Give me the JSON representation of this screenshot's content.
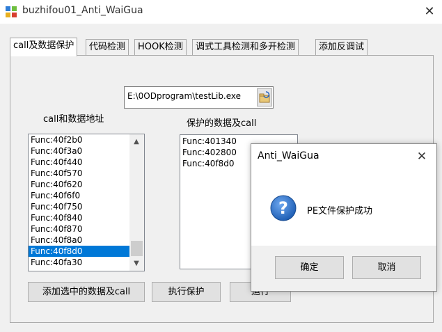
{
  "window": {
    "title": "buzhifou01_Anti_WaiGua",
    "close_glyph": "✕"
  },
  "tabs": [
    {
      "label": "call及数据保护"
    },
    {
      "label": "代码检测"
    },
    {
      "label": "HOOK检测"
    },
    {
      "label": "调式工具检测和多开检测"
    },
    {
      "label": "添加反调试"
    }
  ],
  "file": {
    "path": "E:\\0ODprogram\\testLib.exe",
    "browse_icon": "folder-browse-icon"
  },
  "call_list": {
    "caption": "call和数据地址",
    "items": [
      "Func:40f2b0",
      "Func:40f3a0",
      "Func:40f440",
      "Func:40f570",
      "Func:40f620",
      "Func:40f6f0",
      "Func:40f750",
      "Func:40f840",
      "Func:40f870",
      "Func:40f8a0",
      "Func:40f8d0",
      "Func:40fa30"
    ],
    "selected": "Func:40f8d0"
  },
  "protected_list": {
    "caption": "保护的数据及call",
    "items": [
      "Func:401340",
      "Func:402800",
      "Func:40f8d0"
    ]
  },
  "buttons": {
    "add": "添加选中的数据及call",
    "protect": "执行保护",
    "run": "运行"
  },
  "dialog": {
    "title": "Anti_WaiGua",
    "message": "PE文件保护成功",
    "icon": "question-icon",
    "ok": "确定",
    "cancel": "取消",
    "close_glyph": "✕"
  },
  "colors": {
    "selection": "#0078d7",
    "question_icon": "#1f5fb5"
  }
}
